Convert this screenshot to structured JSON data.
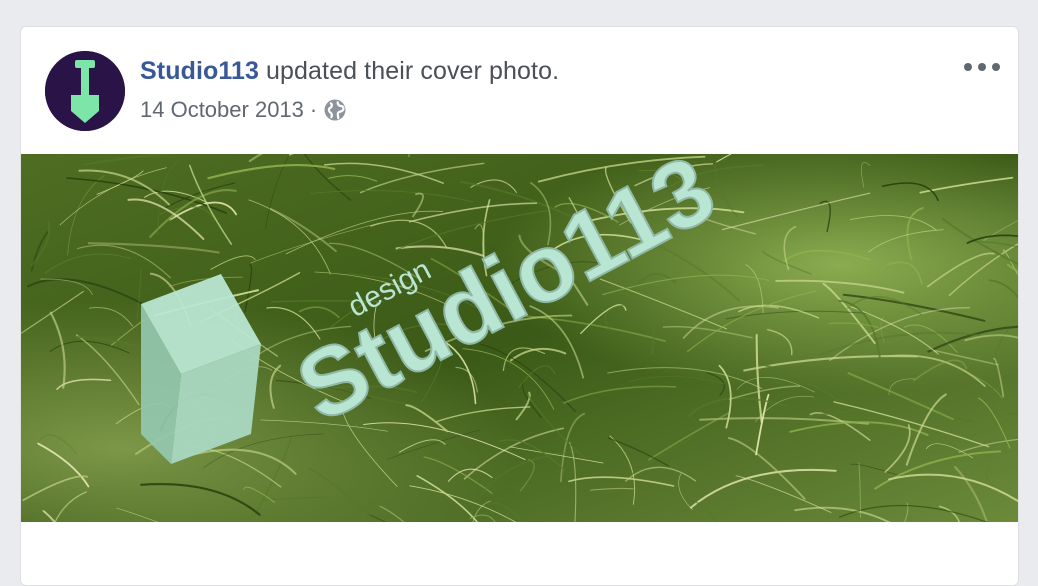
{
  "post": {
    "author": "Studio113",
    "action_text": " updated their cover photo.",
    "date": "14 October 2013",
    "separator": "·",
    "privacy_icon": "globe-icon",
    "more_icon": "more-options-icon"
  },
  "avatar": {
    "icon": "shovel-icon",
    "background": "#2a1447",
    "accent": "#7ee5a8"
  },
  "cover_photo": {
    "logo_word": "Studio113",
    "logo_small": "design",
    "colors": {
      "grass_dark": "#2f4a14",
      "grass_light": "#a9c86b",
      "logo_fill": "#b9e6d2"
    }
  },
  "colors": {
    "author_link": "#385898",
    "text_secondary": "#616770",
    "page_bg": "#e9ebee"
  }
}
